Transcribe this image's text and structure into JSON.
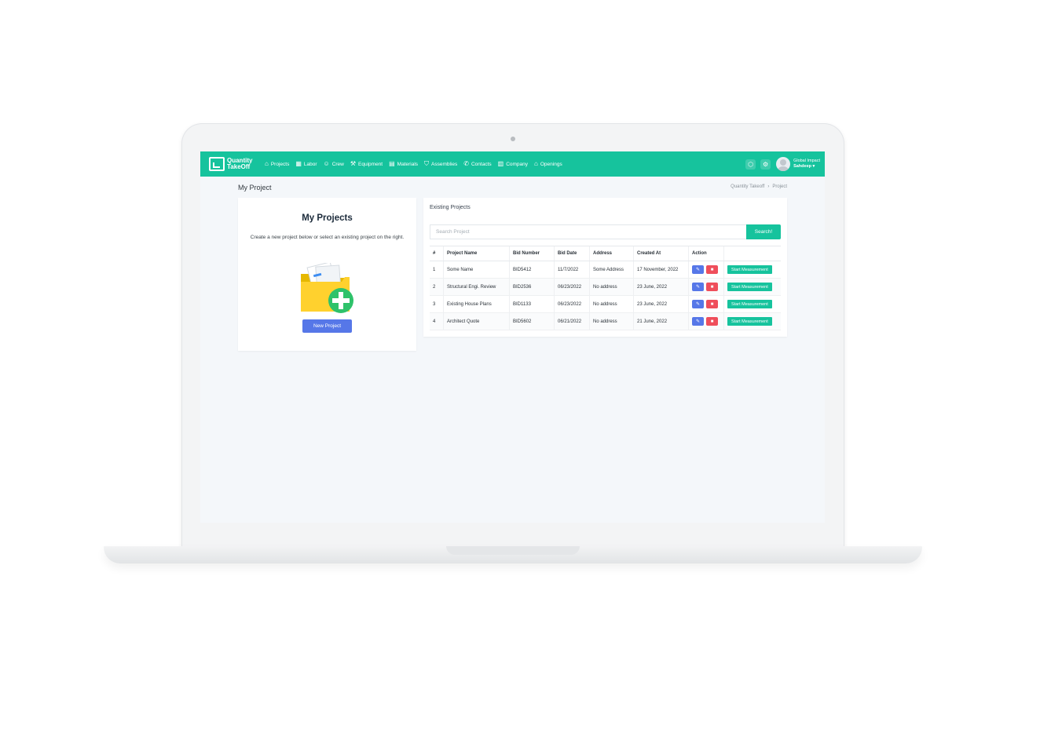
{
  "brand": {
    "line1": "Quantity",
    "line2": "TakeOff"
  },
  "nav": [
    {
      "icon": "⌂",
      "label": "Projects"
    },
    {
      "icon": "▦",
      "label": "Labor"
    },
    {
      "icon": "☺",
      "label": "Crew"
    },
    {
      "icon": "⚒",
      "label": "Equipment"
    },
    {
      "icon": "▤",
      "label": "Materials"
    },
    {
      "icon": "⛉",
      "label": "Assemblies"
    },
    {
      "icon": "✆",
      "label": "Contacts"
    },
    {
      "icon": "▥",
      "label": "Company"
    },
    {
      "icon": "⌂",
      "label": "Openings"
    }
  ],
  "user": {
    "company": "Global Impact",
    "name": "Sahdeep ▾"
  },
  "page": {
    "title": "My Project",
    "breadcrumb": [
      "Quantity Takeoff",
      "Project"
    ]
  },
  "left_card": {
    "title": "My Projects",
    "description": "Create a new project below or select an existing project on the right.",
    "button": "New Project"
  },
  "right_card": {
    "title": "Existing Projects",
    "search_placeholder": "Search Project",
    "search_button": "Search!",
    "columns": [
      "#",
      "Project Name",
      "Bid Number",
      "Bid Date",
      "Address",
      "Created At",
      "Action",
      ""
    ],
    "rows": [
      {
        "num": "1",
        "name": "Some Name",
        "bid": "BID5412",
        "date": "11/7/2022",
        "address": "Some Address",
        "created": "17 November, 2022"
      },
      {
        "num": "2",
        "name": "Structural Engi. Review",
        "bid": "BID2536",
        "date": "06/23/2022",
        "address": "No address",
        "created": "23 June, 2022"
      },
      {
        "num": "3",
        "name": "Existing House Plans",
        "bid": "BID1133",
        "date": "06/23/2022",
        "address": "No address",
        "created": "23 June, 2022"
      },
      {
        "num": "4",
        "name": "Architect Quote",
        "bid": "BID5602",
        "date": "06/21/2022",
        "address": "No address",
        "created": "21 June, 2022"
      }
    ],
    "row_button": "Start Measurement"
  },
  "colors": {
    "primary": "#16c39d",
    "blue": "#5677e8",
    "red": "#ef4e5b"
  }
}
